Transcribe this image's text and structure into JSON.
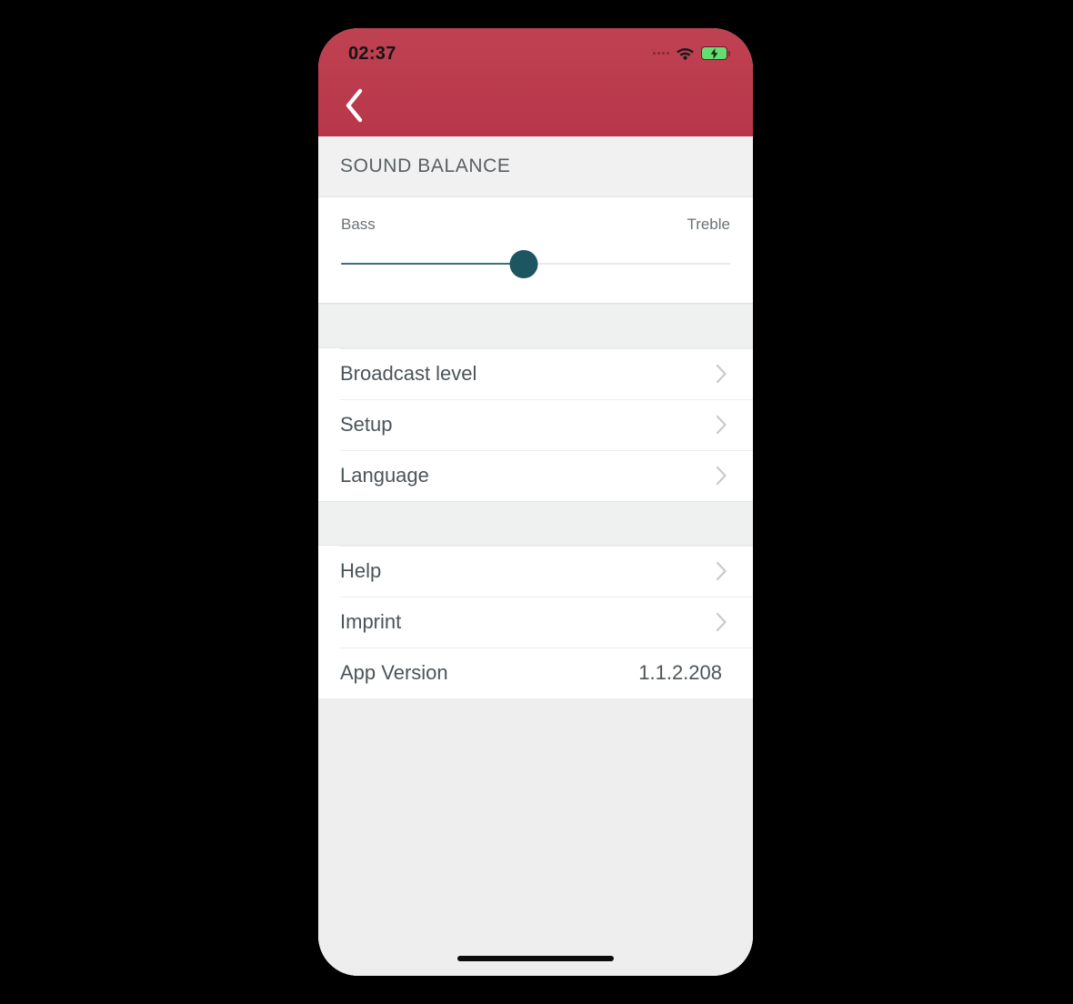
{
  "status_bar": {
    "time": "02:37",
    "signal_icon": "signal-dots-icon",
    "wifi_icon": "wifi-icon",
    "battery_icon": "battery-charging-icon"
  },
  "navbar": {
    "back_icon": "chevron-left-icon"
  },
  "sound_balance": {
    "section_title": "SOUND BALANCE",
    "left_label": "Bass",
    "right_label": "Treble",
    "slider_percent": 47
  },
  "menu_groups": [
    {
      "rows": [
        {
          "label": "Broadcast level",
          "accessory": "chevron-right-icon"
        },
        {
          "label": "Setup",
          "accessory": "chevron-right-icon"
        },
        {
          "label": "Language",
          "accessory": "chevron-right-icon"
        }
      ]
    },
    {
      "rows": [
        {
          "label": "Help",
          "accessory": "chevron-right-icon"
        },
        {
          "label": "Imprint",
          "accessory": "chevron-right-icon"
        },
        {
          "label": "App Version",
          "value": "1.1.2.208",
          "accessory": "none"
        }
      ]
    }
  ],
  "home_indicator": "home-indicator",
  "colors": {
    "header_red_top": "#bf4252",
    "header_red_bottom": "#b8364a",
    "slider_thumb_teal": "#1d5560",
    "slider_fill_teal": "#3d7078",
    "text_slate": "#4b5458",
    "chevron_gray": "#c9cccd",
    "battery_green": "#64dd73",
    "screen_gray": "#eeeeee"
  }
}
